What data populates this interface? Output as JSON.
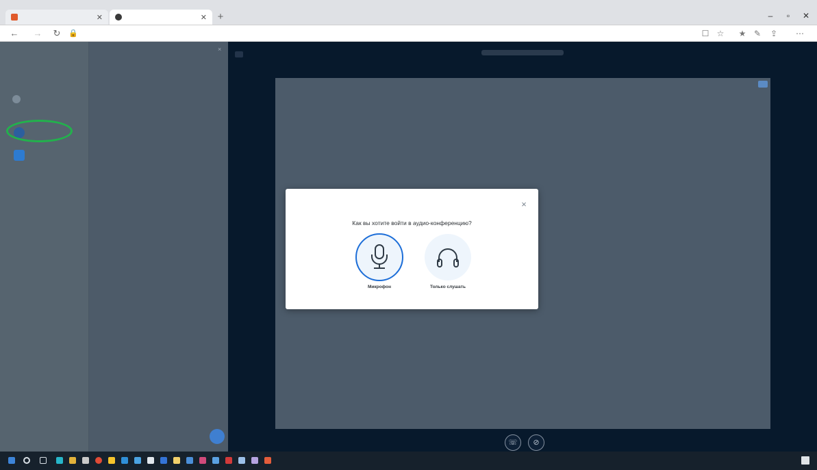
{
  "browser": {
    "tabs": [
      {
        "title": "",
        "favicon_color": "#e05a2b"
      },
      {
        "title": "",
        "favicon_color": "#3a3a3a"
      }
    ],
    "new_tab_label": "+",
    "url": "",
    "window_controls": {
      "minimize": "–",
      "maximize": "▫",
      "close": "✕"
    }
  },
  "sidebar": {
    "user_name": "",
    "section_label": "",
    "rows": [
      {
        "label": "",
        "avatar_color": "#7d8c99"
      },
      {
        "label": "",
        "avatar_color": "#2c5f9e"
      },
      {
        "label": "",
        "avatar_color": "#2d7bd1"
      }
    ],
    "chat_panel_title": ""
  },
  "meeting": {
    "title": ""
  },
  "audio_modal": {
    "question": "Как вы хотите войти в аудио-конференцию?",
    "close_symbol": "×",
    "options": [
      {
        "label": "Микрофон",
        "icon": "microphone-icon",
        "selected": true
      },
      {
        "label": "Только слушать",
        "icon": "headphones-icon",
        "selected": false
      }
    ]
  },
  "colors": {
    "accent": "#1d6ed8",
    "highlight_annotation": "#22b24c",
    "app_background": "#07192c",
    "sidebar": "#4f5d6c",
    "presentation": "#4c5b6a"
  },
  "taskbar": {
    "clock": "",
    "pinned_app_colors": [
      "#3d84d8",
      "#d9e0e6",
      "#27b6c9",
      "#e2b23a",
      "#c9c9c9",
      "#e04b36",
      "#f5c42c",
      "#2f8fd8",
      "#4ba3e2",
      "#e0e6ec",
      "#3473d6",
      "#f2d06b",
      "#4b8fd9",
      "#d04a7a",
      "#5aa0e0",
      "#d23a3a",
      "#9cc0e8",
      "#b5a3e0",
      "#e45d3b"
    ]
  }
}
